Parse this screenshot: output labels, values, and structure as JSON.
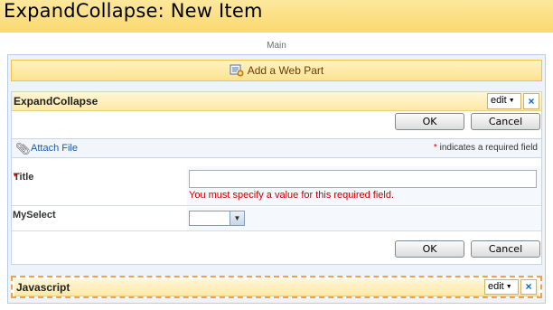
{
  "page": {
    "title": "ExpandCollapse: New Item"
  },
  "zone": {
    "label": "Main",
    "add_web_part": "Add a Web Part"
  },
  "webpart1": {
    "title": "ExpandCollapse",
    "edit_label": "edit",
    "close_label": "×",
    "ok_label": "OK",
    "cancel_label": "Cancel",
    "attach_file": "Attach File",
    "required_star": "*",
    "required_note": "indicates a required field",
    "fields": {
      "title_label": "Title",
      "title_star": "*",
      "title_value": "",
      "title_error": "You must specify a value for this required field.",
      "myselect_label": "MySelect",
      "myselect_value": ""
    },
    "bottom_ok_label": "OK",
    "bottom_cancel_label": "Cancel"
  },
  "webpart2": {
    "title": "Javascript",
    "edit_label": "edit",
    "close_label": "×"
  },
  "colors": {
    "title_bar": "#fbd96f",
    "error": "#cc0000",
    "link": "#1f5aa6",
    "selected_border": "#f2a14a"
  },
  "icons": {
    "add_web_part": "add-web-part-icon",
    "attach": "paperclip-icon",
    "dropdown": "chevron-down-icon"
  }
}
